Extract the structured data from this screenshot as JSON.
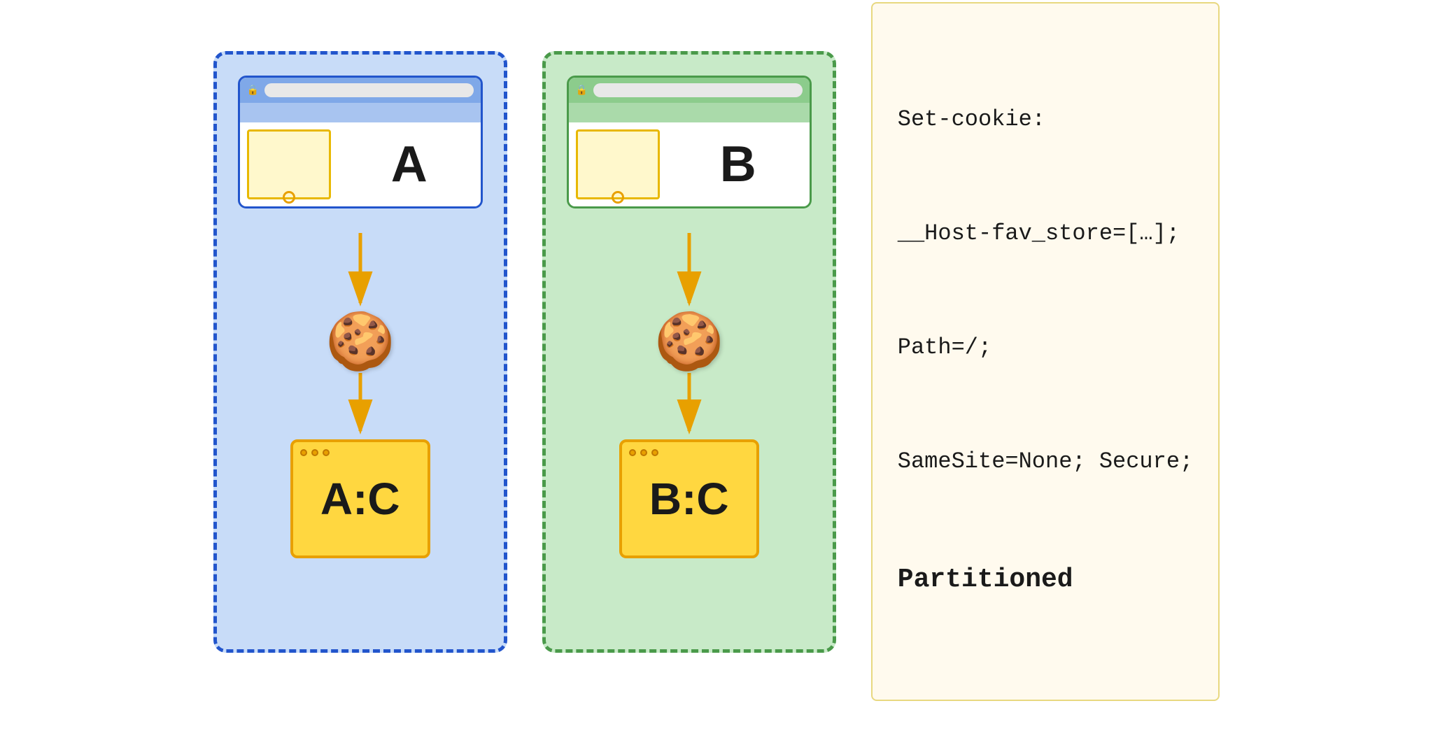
{
  "partitions": [
    {
      "id": "partition-a",
      "color": "blue",
      "site_label": "A",
      "storage_label": "A:C",
      "iframe_has_dot": true
    },
    {
      "id": "partition-b",
      "color": "green",
      "site_label": "B",
      "storage_label": "B:C",
      "iframe_has_dot": true
    }
  ],
  "code_block": {
    "lines": [
      "Set-cookie:",
      "__Host-fav_store=[…];",
      "Path=/;",
      "SameSite=None; Secure;",
      "Partitioned"
    ],
    "bold_line_index": 4
  }
}
